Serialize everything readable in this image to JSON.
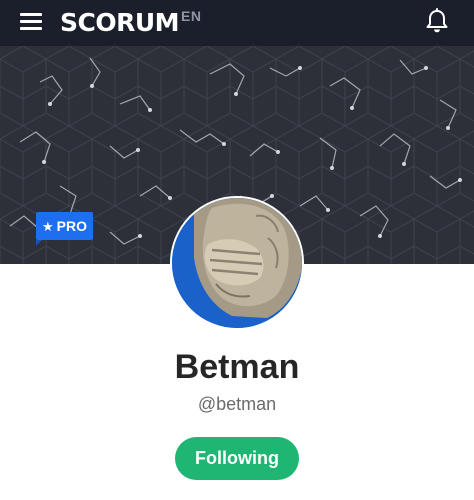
{
  "header": {
    "logo_text": "SCORUM",
    "language": "EN",
    "menu_icon": "hamburger-menu-icon",
    "notifications_icon": "bell-icon"
  },
  "profile": {
    "badge": {
      "icon": "star-icon",
      "label": "PRO"
    },
    "display_name": "Betman",
    "username": "@betman",
    "follow_button_label": "Following"
  },
  "colors": {
    "topbar": "#1b1f2b",
    "cover": "#2e3039",
    "pro_badge": "#1e6ff0",
    "follow_button": "#1fb572",
    "avatar_ring": "#1a62c9"
  }
}
